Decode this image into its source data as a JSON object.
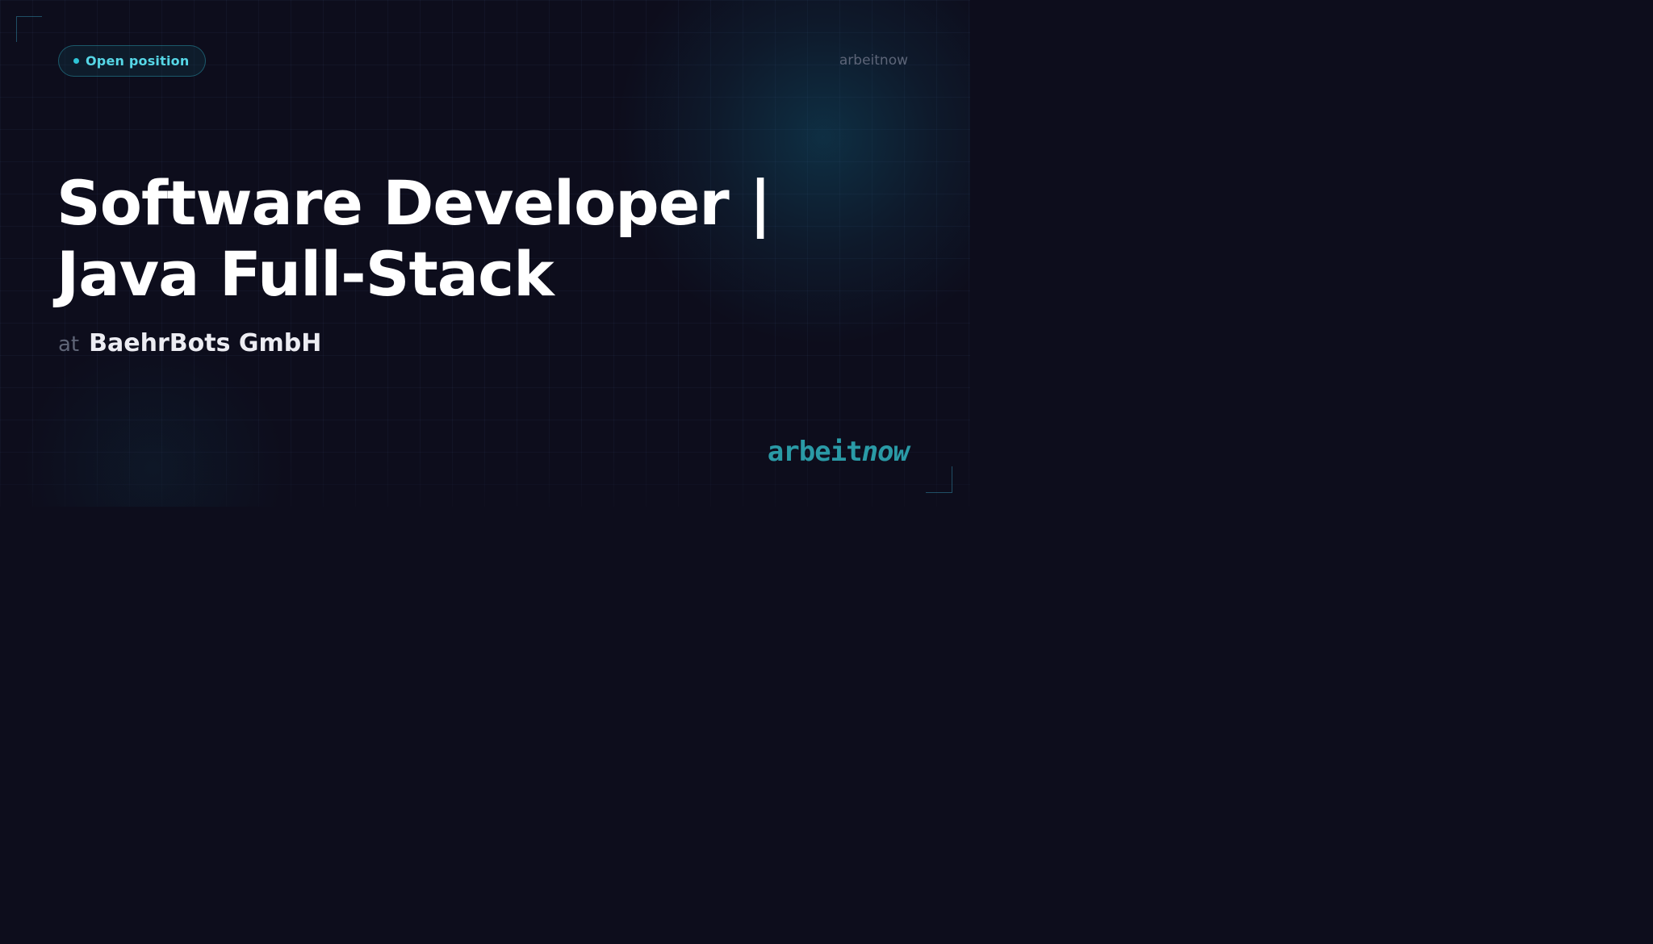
{
  "badge": {
    "label": "Open position"
  },
  "brand": {
    "top_text": "arbeitnow"
  },
  "job": {
    "title_line1": "Software Developer |",
    "title_line2": "Java Full-Stack"
  },
  "company": {
    "prefix": "at",
    "name": "BaehrBots GmbH"
  },
  "logo": {
    "part1": "arbeit",
    "part2": "now"
  },
  "colors": {
    "background": "#0d0d1c",
    "accent": "#2ec4d6",
    "badge_text": "#56d6e6",
    "logo": "#2a9aa6",
    "headline": "#ffffff",
    "muted": "#5f6577"
  }
}
